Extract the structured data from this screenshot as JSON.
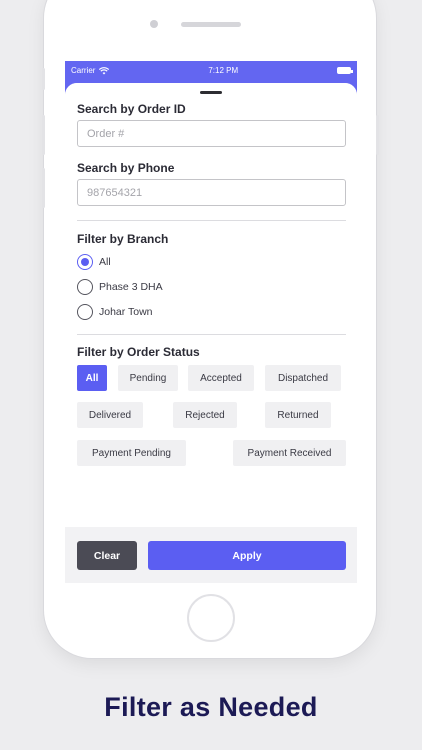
{
  "status_bar": {
    "carrier": "Carrier",
    "time": "7:12 PM"
  },
  "search_order": {
    "label": "Search by Order ID",
    "placeholder": "Order #"
  },
  "search_phone": {
    "label": "Search by Phone",
    "placeholder": "987654321"
  },
  "branch": {
    "label": "Filter by Branch",
    "options": [
      "All",
      "Phase 3 DHA",
      "Johar Town"
    ],
    "selected": "All"
  },
  "order_status": {
    "label": "Filter by Order Status",
    "chips": [
      "All",
      "Pending",
      "Accepted",
      "Dispatched",
      "Delivered",
      "Rejected",
      "Returned",
      "Payment Pending",
      "Payment Received"
    ],
    "selected": "All"
  },
  "actions": {
    "clear": "Clear",
    "apply": "Apply"
  },
  "headline": "Filter as Needed",
  "colors": {
    "accent": "#5b5ef2",
    "header": "#6366f1",
    "clear_button": "#4b4b55",
    "headline": "#1c1a55"
  }
}
